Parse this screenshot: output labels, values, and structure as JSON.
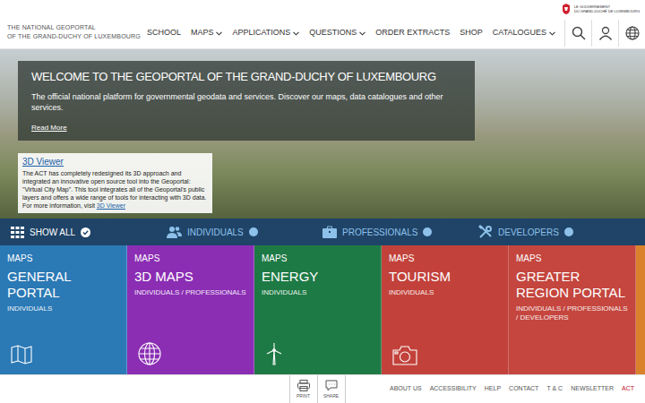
{
  "header": {
    "site_title": [
      "THE NATIONAL GEOPORTAL",
      "OF THE GRAND-DUCHY OF LUXEMBOURG"
    ],
    "government": [
      "LE GOUVERNEMENT",
      "DU GRAND-DUCHÉ DE LUXEMBOURG"
    ]
  },
  "nav": [
    {
      "label": "SCHOOL",
      "has_menu": false
    },
    {
      "label": "MAPS",
      "has_menu": true
    },
    {
      "label": "APPLICATIONS",
      "has_menu": true
    },
    {
      "label": "QUESTIONS",
      "has_menu": true
    },
    {
      "label": "ORDER EXTRACTS",
      "has_menu": false
    },
    {
      "label": "SHOP",
      "has_menu": false
    },
    {
      "label": "CATALOGUES",
      "has_menu": true
    }
  ],
  "hero": {
    "title": "WELCOME TO THE GEOPORTAL OF THE GRAND-DUCHY OF LUXEMBOURG",
    "subtitle": "The official national platform for governmental geodata and services. Discover our maps, data catalogues and other services.",
    "read_more": "Read More",
    "viewer": {
      "title": "3D Viewer",
      "text": "The ACT has completely redesigned its 3D approach and integrated an innovative open source tool into the Geoportal: \"Virtual City Map\". This tool integrates all of the Geoportal's public layers and offers a wide range of tools for interacting with 3D data. For more information, visit ",
      "link": "3D Viewer"
    }
  },
  "filters": [
    {
      "label": "SHOW ALL",
      "selected": true
    },
    {
      "label": "INDIVIDUALS",
      "selected": false
    },
    {
      "label": "PROFESSIONALS",
      "selected": false
    },
    {
      "label": "DEVELOPERS",
      "selected": false
    }
  ],
  "tiles": [
    {
      "category": "MAPS",
      "title": "GENERAL PORTAL",
      "audience": "INDIVIDUALS",
      "color": "#2b79b5"
    },
    {
      "category": "MAPS",
      "title": "3D MAPS",
      "audience": "INDIVIDUALS / PROFESSIONALS",
      "color": "#8b2eb4"
    },
    {
      "category": "MAPS",
      "title": "ENERGY",
      "audience": "INDIVIDUALS",
      "color": "#1e7a45"
    },
    {
      "category": "MAPS",
      "title": "TOURISM",
      "audience": "INDIVIDUALS",
      "color": "#c2423b"
    },
    {
      "category": "MAPS",
      "title": "GREATER REGION PORTAL",
      "audience": "INDIVIDUALS / PROFESSIONALS / DEVELOPERS",
      "color": "#c4463e"
    }
  ],
  "footer": {
    "actions": [
      "PRINT",
      "SHARE"
    ],
    "links": [
      {
        "label": "ABOUT US",
        "highlighted": false
      },
      {
        "label": "ACCESSIBILITY",
        "highlighted": false
      },
      {
        "label": "HELP",
        "highlighted": false
      },
      {
        "label": "CONTACT",
        "highlighted": false
      },
      {
        "label": "T & C",
        "highlighted": false
      },
      {
        "label": "NEWSLETTER",
        "highlighted": false
      },
      {
        "label": "ACT",
        "highlighted": true
      }
    ]
  }
}
